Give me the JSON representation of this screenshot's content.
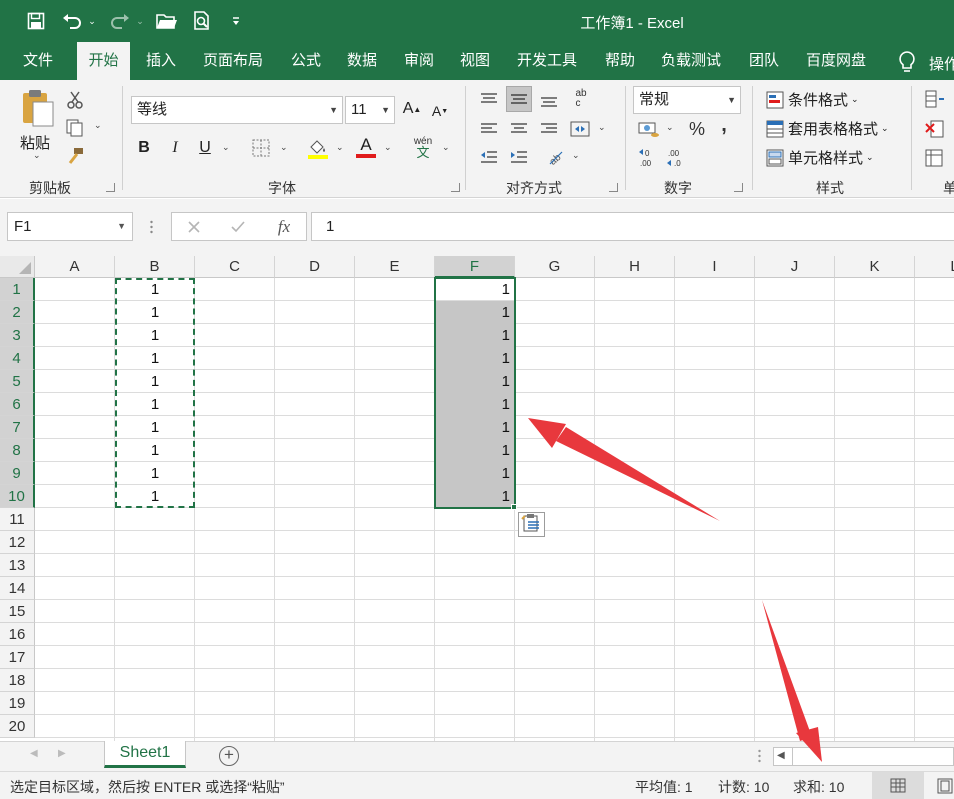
{
  "window": {
    "title": "工作簿1 - Excel"
  },
  "quick_access": {
    "icons": [
      "save-icon",
      "undo-icon",
      "redo-icon",
      "open-icon",
      "print-preview-icon",
      "customize-icon"
    ]
  },
  "tabs": [
    {
      "label": "文件",
      "active": false
    },
    {
      "label": "开始",
      "active": true
    },
    {
      "label": "插入",
      "active": false
    },
    {
      "label": "页面布局",
      "active": false
    },
    {
      "label": "公式",
      "active": false
    },
    {
      "label": "数据",
      "active": false
    },
    {
      "label": "审阅",
      "active": false
    },
    {
      "label": "视图",
      "active": false
    },
    {
      "label": "开发工具",
      "active": false
    },
    {
      "label": "帮助",
      "active": false
    },
    {
      "label": "负载测试",
      "active": false
    },
    {
      "label": "团队",
      "active": false
    },
    {
      "label": "百度网盘",
      "active": false
    }
  ],
  "tell_me": {
    "label": "操作"
  },
  "ribbon": {
    "clipboard": {
      "paste_label": "粘贴",
      "group_label": "剪贴板"
    },
    "font": {
      "font_name": "等线",
      "font_size": "11",
      "bold": "B",
      "italic": "I",
      "underline": "U",
      "phonetic": "wén",
      "grow": "A",
      "shrink": "A",
      "font_color_letter": "A",
      "group_label": "字体"
    },
    "alignment": {
      "wrap_label": "ab\nc",
      "group_label": "对齐方式"
    },
    "number": {
      "format": "常规",
      "percent": "%",
      "comma": ",",
      "group_label": "数字"
    },
    "styles": {
      "conditional": "条件格式",
      "table": "套用表格格式",
      "cell": "单元格样式",
      "group_label": "样式"
    },
    "cells": {
      "group_label": "单"
    }
  },
  "formula_bar": {
    "name_box": "F1",
    "fx": "fx",
    "value": "1"
  },
  "grid": {
    "columns": [
      "A",
      "B",
      "C",
      "D",
      "E",
      "F",
      "G",
      "H",
      "I",
      "J",
      "K",
      "L"
    ],
    "rows": [
      "1",
      "2",
      "3",
      "4",
      "5",
      "6",
      "7",
      "8",
      "9",
      "10",
      "11",
      "12",
      "13",
      "14",
      "15",
      "16",
      "17",
      "18",
      "19",
      "20"
    ],
    "selected_column": "F",
    "column_b": [
      "1",
      "1",
      "1",
      "1",
      "1",
      "1",
      "1",
      "1",
      "1",
      "1"
    ],
    "column_f": [
      "1",
      "1",
      "1",
      "1",
      "1",
      "1",
      "1",
      "1",
      "1",
      "1"
    ]
  },
  "sheet_tabs": {
    "active": "Sheet1"
  },
  "status": {
    "message": "选定目标区域，然后按 ENTER 或选择“粘贴”",
    "average": "平均值: 1",
    "count": "计数: 10",
    "sum": "求和: 10"
  },
  "colors": {
    "brand_green": "#217346",
    "selection_fill": "#c6c6c6",
    "annotation_red": "#e8383d"
  }
}
